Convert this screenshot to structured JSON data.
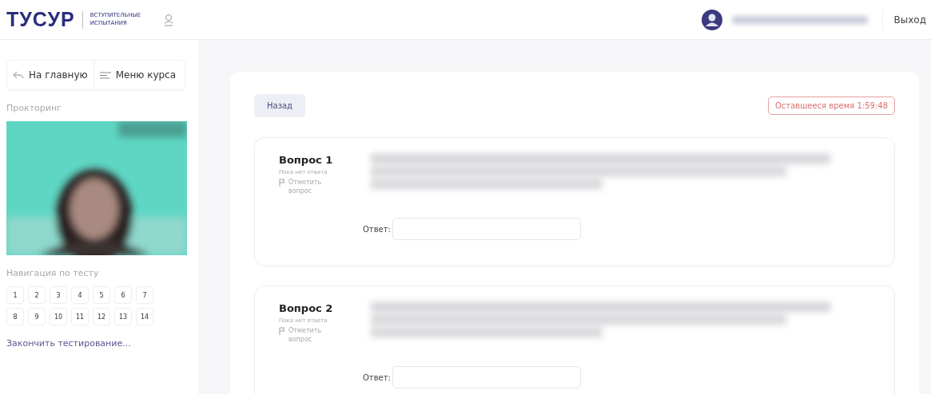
{
  "header": {
    "logo": "ТУСУР",
    "logo_subtitle": "ВСТУПИТЕЛЬНЫЕ ИСПЫТАНИЯ",
    "logout": "Выход"
  },
  "sidebar": {
    "buttons": [
      {
        "kind": "back",
        "label": "На главную"
      },
      {
        "kind": "menu",
        "label": "Меню курса"
      }
    ],
    "proctoring_label": "Прокторинг",
    "navigation_label": "Навигация по тесту",
    "question_numbers": [
      "1",
      "2",
      "3",
      "4",
      "5",
      "6",
      "7",
      "8",
      "9",
      "10",
      "11",
      "12",
      "13",
      "14"
    ],
    "finish_link": "Закончить тестирование..."
  },
  "main": {
    "back_button": "Назад",
    "timer": "Оставшееся время 1:59:48"
  },
  "questions": [
    {
      "title": "Вопрос 1",
      "status": "Пока нет ответа",
      "flag_label": "Отметить вопрос",
      "answer_label": "Ответ:"
    },
    {
      "title": "Вопрос 2",
      "status": "Пока нет ответа",
      "flag_label": "Отметить вопрос",
      "answer_label": "Ответ:"
    }
  ]
}
